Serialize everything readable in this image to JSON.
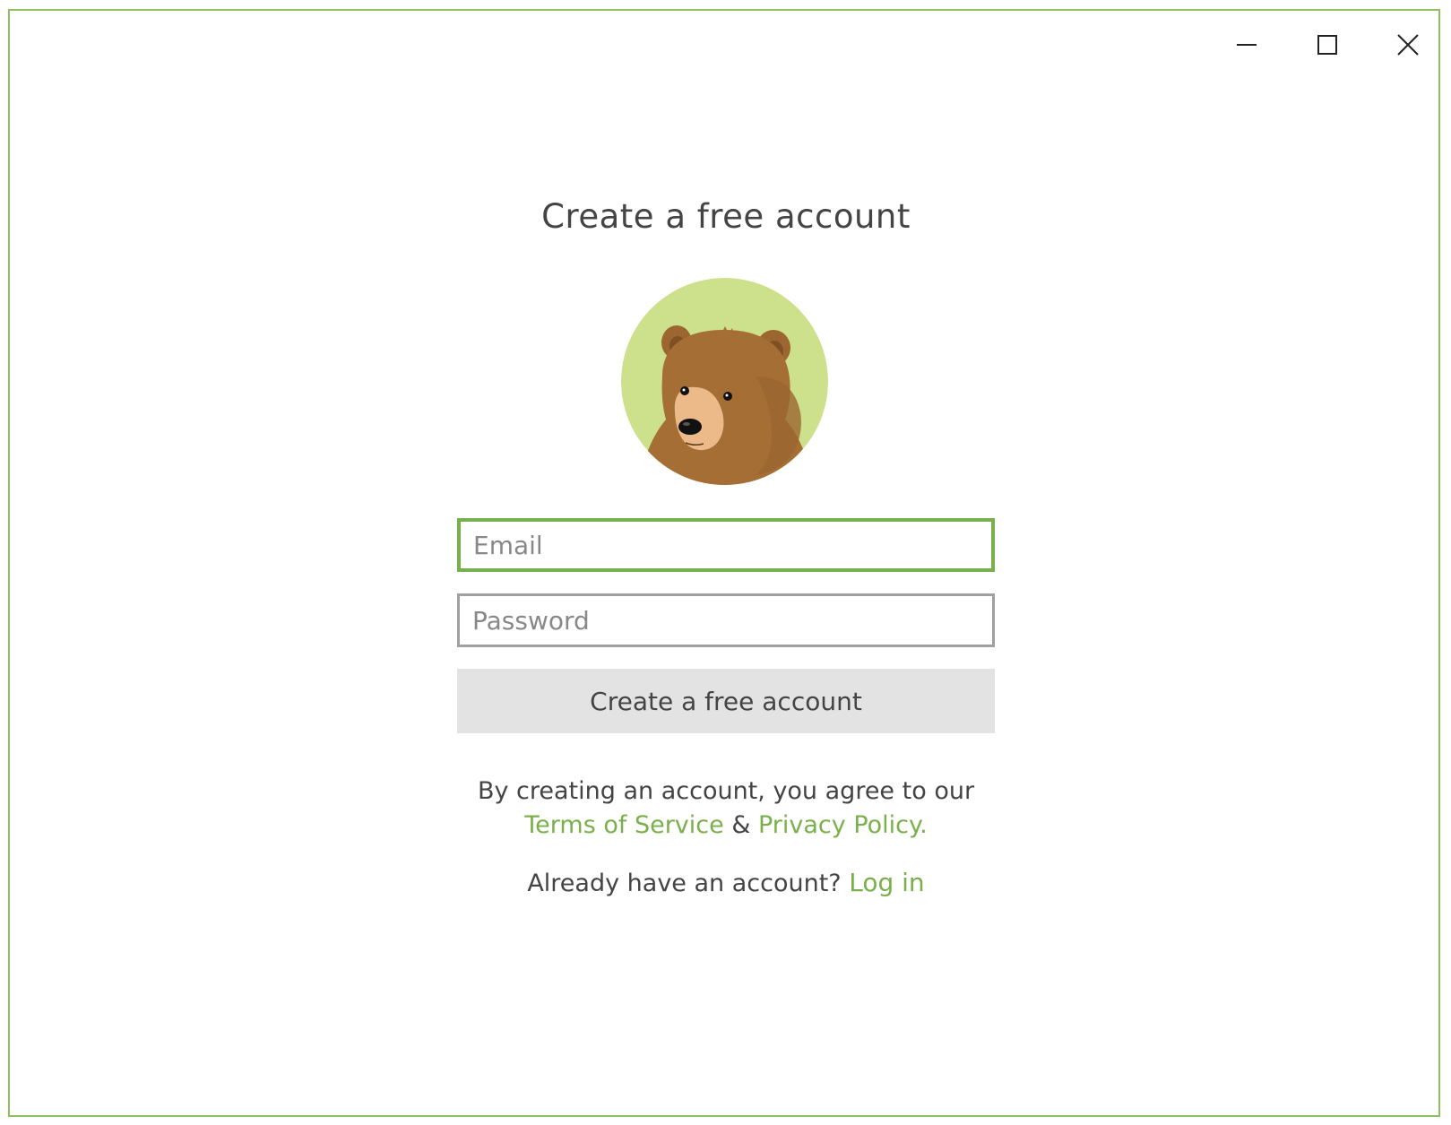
{
  "window": {
    "accent_color": "#8fbf5e",
    "controls": {
      "minimize_icon": "minimize-icon",
      "maximize_icon": "maximize-icon",
      "close_icon": "close-icon"
    }
  },
  "form": {
    "title": "Create a free account",
    "avatar_icon": "bear-icon",
    "email": {
      "value": "",
      "placeholder": "Email"
    },
    "password": {
      "value": "",
      "placeholder": "Password"
    },
    "submit_label": "Create a free account",
    "legal": {
      "prefix": "By creating an account, you agree to our",
      "terms_label": "Terms of Service",
      "and": "&",
      "privacy_label": "Privacy Policy."
    },
    "login": {
      "prompt": "Already have an account?",
      "link_label": "Log in"
    },
    "colors": {
      "link": "#7ab04a",
      "focus_border": "#79b04f",
      "button_bg": "#e3e3e3",
      "avatar_bg": "#cde08b",
      "bear_fur": "#a56e35",
      "bear_muzzle": "#ecba89"
    }
  }
}
